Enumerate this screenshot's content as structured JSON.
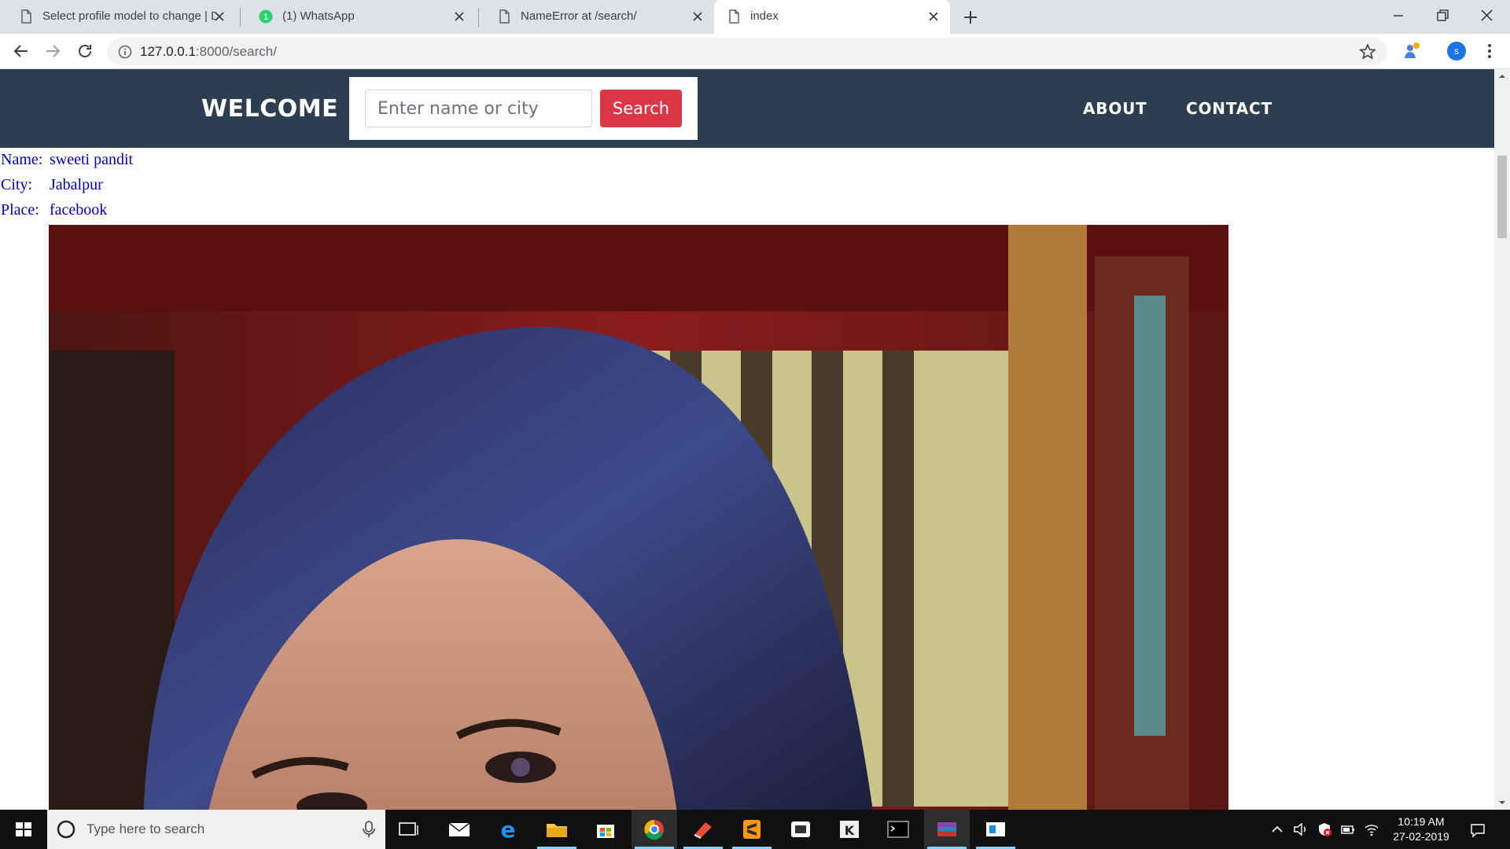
{
  "browser": {
    "tabs": [
      {
        "title": "Select profile model to change | D",
        "favicon": "page-icon"
      },
      {
        "title": "(1) WhatsApp",
        "favicon": "whatsapp-icon",
        "badge": "1"
      },
      {
        "title": "NameError at /search/",
        "favicon": "page-icon"
      },
      {
        "title": "index",
        "favicon": "page-icon",
        "active": true
      }
    ],
    "url_host": "127.0.0.1",
    "url_path": ":8000/search/",
    "profile_initial": "s"
  },
  "navbar": {
    "brand": "WELCOME",
    "search_placeholder": "Enter name or city",
    "search_button": "Search",
    "links": [
      "ABOUT",
      "CONTACT"
    ],
    "background": "#2c3e50",
    "button_color": "#dc3545"
  },
  "result": {
    "name_label": "Name:",
    "name_value": "sweeti pandit",
    "city_label": "City:",
    "city_value": "Jabalpur",
    "place_label": "Place:",
    "place_value": "facebook",
    "text_color": "#0000cc"
  },
  "taskbar": {
    "search_placeholder": "Type here to search",
    "time": "10:19 AM",
    "date": "27-02-2019",
    "apps": [
      "task-view-icon",
      "mail-icon",
      "edge-icon",
      "file-explorer-icon",
      "store-icon",
      "chrome-icon",
      "app-icon",
      "sublime-icon",
      "app-icon",
      "app-icon",
      "terminal-icon",
      "winrar-icon",
      "window-icon"
    ]
  }
}
